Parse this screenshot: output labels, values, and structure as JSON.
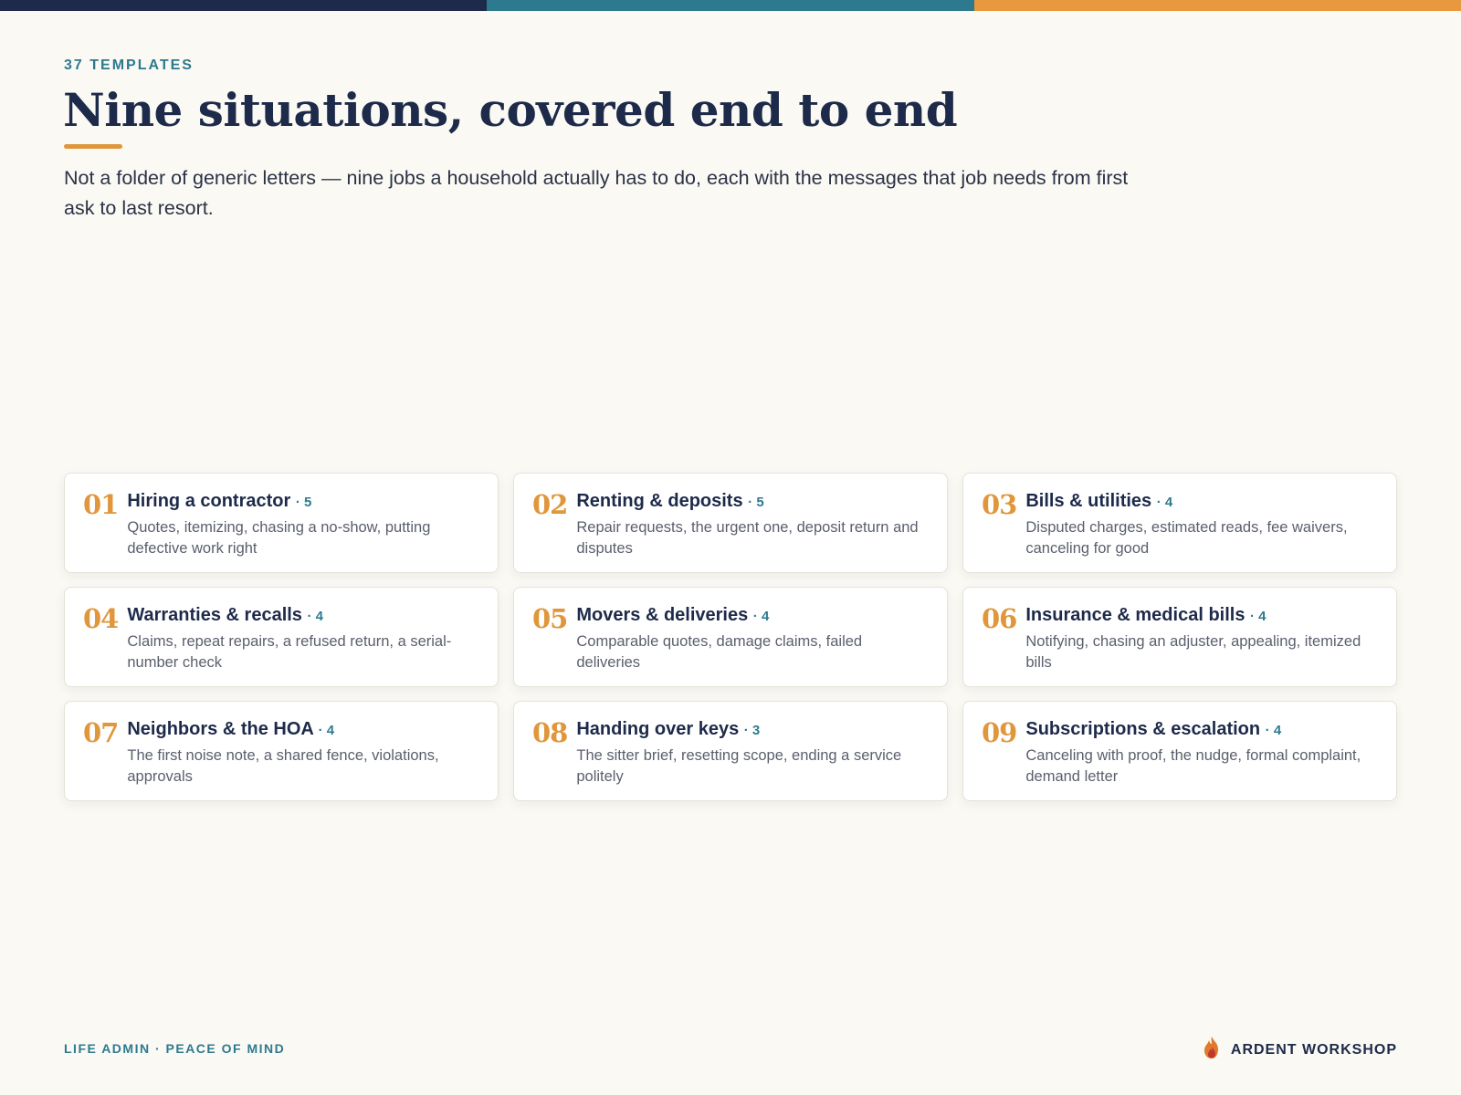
{
  "colors": {
    "background": "#faf9f4",
    "navy": "#1d2a4a",
    "teal": "#2d7a8f",
    "orange": "#e0963a",
    "topbar": [
      "#1d2a4a",
      "#2d7a8f",
      "#e8983e"
    ]
  },
  "header": {
    "eyebrow": "37 TEMPLATES",
    "title": "Nine situations, covered end to end",
    "lead": "Not a folder of generic letters — nine jobs a household actually has to do, each with the messages that job needs from first ask to last resort."
  },
  "cards": [
    {
      "num": "01",
      "title": "Hiring a contractor",
      "count": "· 5",
      "desc": "Quotes, itemizing, chasing a no-show, putting defective work right"
    },
    {
      "num": "02",
      "title": "Renting & deposits",
      "count": "· 5",
      "desc": "Repair requests, the urgent one, deposit return and disputes"
    },
    {
      "num": "03",
      "title": "Bills & utilities",
      "count": "· 4",
      "desc": "Disputed charges, estimated reads, fee waivers, canceling for good"
    },
    {
      "num": "04",
      "title": "Warranties & recalls",
      "count": "· 4",
      "desc": "Claims, repeat repairs, a refused return, a serial-number check"
    },
    {
      "num": "05",
      "title": "Movers & deliveries",
      "count": "· 4",
      "desc": "Comparable quotes, damage claims, failed deliveries"
    },
    {
      "num": "06",
      "title": "Insurance & medical bills",
      "count": "· 4",
      "desc": "Notifying, chasing an adjuster, appealing, itemized bills"
    },
    {
      "num": "07",
      "title": "Neighbors & the HOA",
      "count": "· 4",
      "desc": "The first noise note, a shared fence, violations, approvals"
    },
    {
      "num": "08",
      "title": "Handing over keys",
      "count": "· 3",
      "desc": "The sitter brief, resetting scope, ending a service politely"
    },
    {
      "num": "09",
      "title": "Subscriptions & escalation",
      "count": "· 4",
      "desc": "Canceling with proof, the nudge, formal complaint, demand letter"
    }
  ],
  "footer": {
    "tagline": "LIFE ADMIN · PEACE OF MIND",
    "brand": "ARDENT WORKSHOP",
    "brand_icon": "flame-icon"
  }
}
